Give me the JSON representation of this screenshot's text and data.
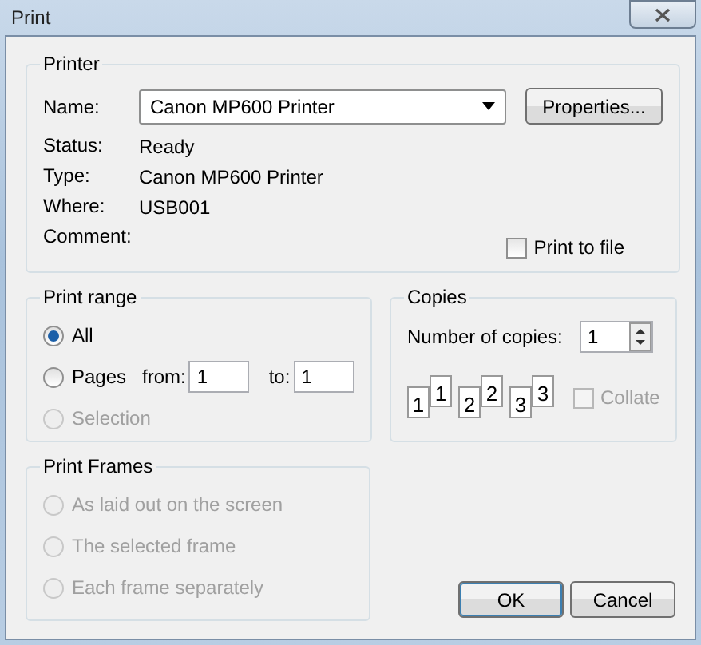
{
  "window": {
    "title": "Print"
  },
  "printer": {
    "legend": "Printer",
    "name_label": "Name:",
    "name_value": "Canon MP600 Printer",
    "properties_button": "Properties...",
    "info": [
      {
        "label": "Status:",
        "value": "Ready"
      },
      {
        "label": "Type:",
        "value": "Canon MP600 Printer"
      },
      {
        "label": "Where:",
        "value": "USB001"
      },
      {
        "label": "Comment:"
      }
    ],
    "print_to_file": {
      "label": "Print to file",
      "checked": false
    }
  },
  "print_range": {
    "legend": "Print range",
    "options": [
      {
        "label": "All",
        "selected": true,
        "disabled": false
      },
      {
        "label": "Pages",
        "selected": false,
        "disabled": false
      },
      {
        "label": "Selection",
        "selected": false,
        "disabled": true
      }
    ],
    "from_label": "from:",
    "from_value": "1",
    "to_label": "to:",
    "to_value": "1"
  },
  "copies": {
    "legend": "Copies",
    "count_label": "Number of copies:",
    "count_value": "1",
    "sets": [
      {
        "front": "1",
        "back": "1"
      },
      {
        "front": "2",
        "back": "2"
      },
      {
        "front": "3",
        "back": "3"
      }
    ],
    "collate": {
      "label": "Collate",
      "checked": false,
      "disabled": true
    }
  },
  "print_frames": {
    "legend": "Print Frames",
    "options": [
      {
        "label": "As laid out on the screen",
        "selected": false,
        "disabled": true
      },
      {
        "label": "The selected frame",
        "selected": false,
        "disabled": true
      },
      {
        "label": "Each frame separately",
        "selected": false,
        "disabled": true
      }
    ]
  },
  "buttons": [
    {
      "label": "OK",
      "kind": "default"
    },
    {
      "label": "Cancel",
      "kind": "normal"
    }
  ]
}
